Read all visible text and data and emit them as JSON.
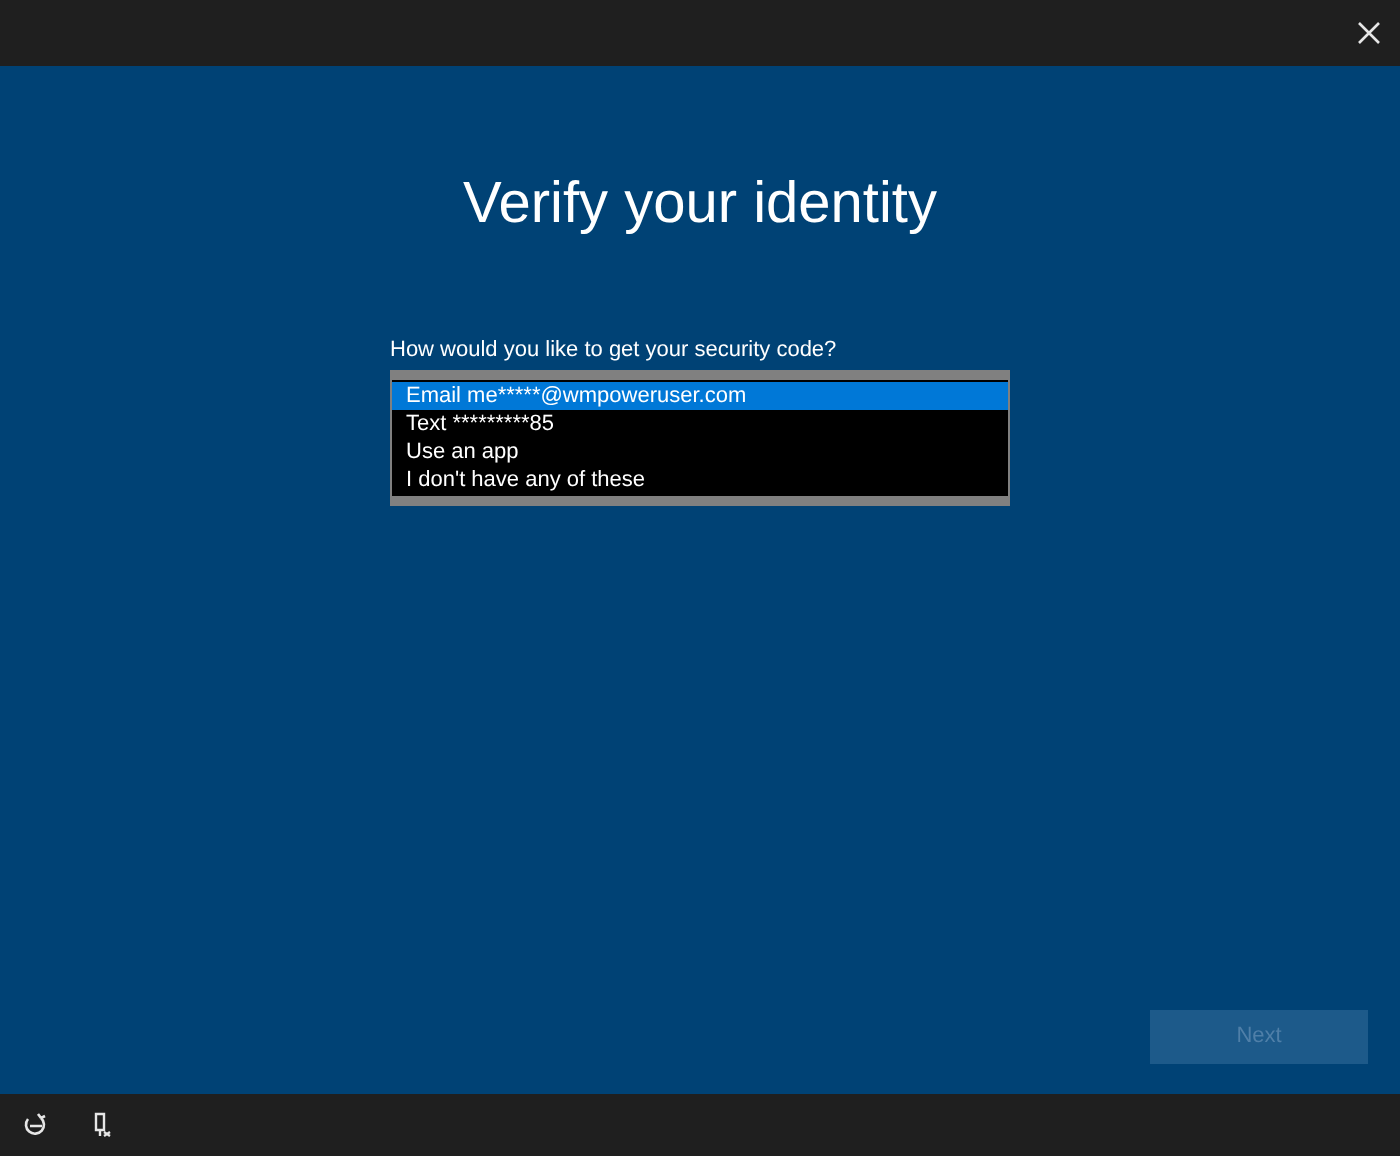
{
  "title": "Verify your identity",
  "prompt": "How would you like to get your security code?",
  "options": [
    {
      "label": "Email me*****@wmpoweruser.com",
      "selected": true
    },
    {
      "label": "Text *********85",
      "selected": false
    },
    {
      "label": "Use an app",
      "selected": false
    },
    {
      "label": "I don't have any of these",
      "selected": false
    }
  ],
  "next_button": {
    "label": "Next",
    "disabled": true
  }
}
